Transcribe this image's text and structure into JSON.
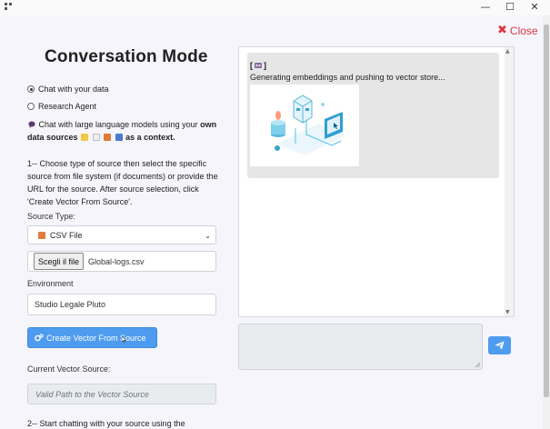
{
  "window": {
    "minimize_glyph": "—",
    "maximize_glyph": "☐",
    "close_glyph": "✕"
  },
  "close_link": {
    "label": "Close",
    "glyph": "✖"
  },
  "title": "Conversation Mode",
  "modes": [
    {
      "label": "Chat with your data",
      "selected": true
    },
    {
      "label": "Research Agent",
      "selected": false
    }
  ],
  "description": {
    "part1": "Chat with large language models using your",
    "bold": "own data sources",
    "part2": "as a context."
  },
  "step1": "1-- Choose type of source then select the specific source from file system (if documents) or provide the URL for the source. After source selection, click 'Create Vector From Source'.",
  "source_type": {
    "label": "Source Type:",
    "selected": "CSV File"
  },
  "file": {
    "button_label": "Scegli il file",
    "file_name": "Global-logs.csv"
  },
  "environment": {
    "label": "Environment",
    "value": "Studio Legale Pluto"
  },
  "create_button": {
    "label": "Create Vector From Source"
  },
  "vector_source": {
    "label": "Current Vector Source:",
    "placeholder": "Valid Path to the Vector Source"
  },
  "step2": "2-- Start chatting with your source using the",
  "chat": {
    "messages": [
      {
        "header_left": "[",
        "header_right": "]",
        "text": "Generating embeddings and pushing to vector store..."
      }
    ]
  },
  "colors": {
    "accent": "#4e9cf0",
    "danger": "#dc3545",
    "message_bg": "#e6e6e6"
  }
}
